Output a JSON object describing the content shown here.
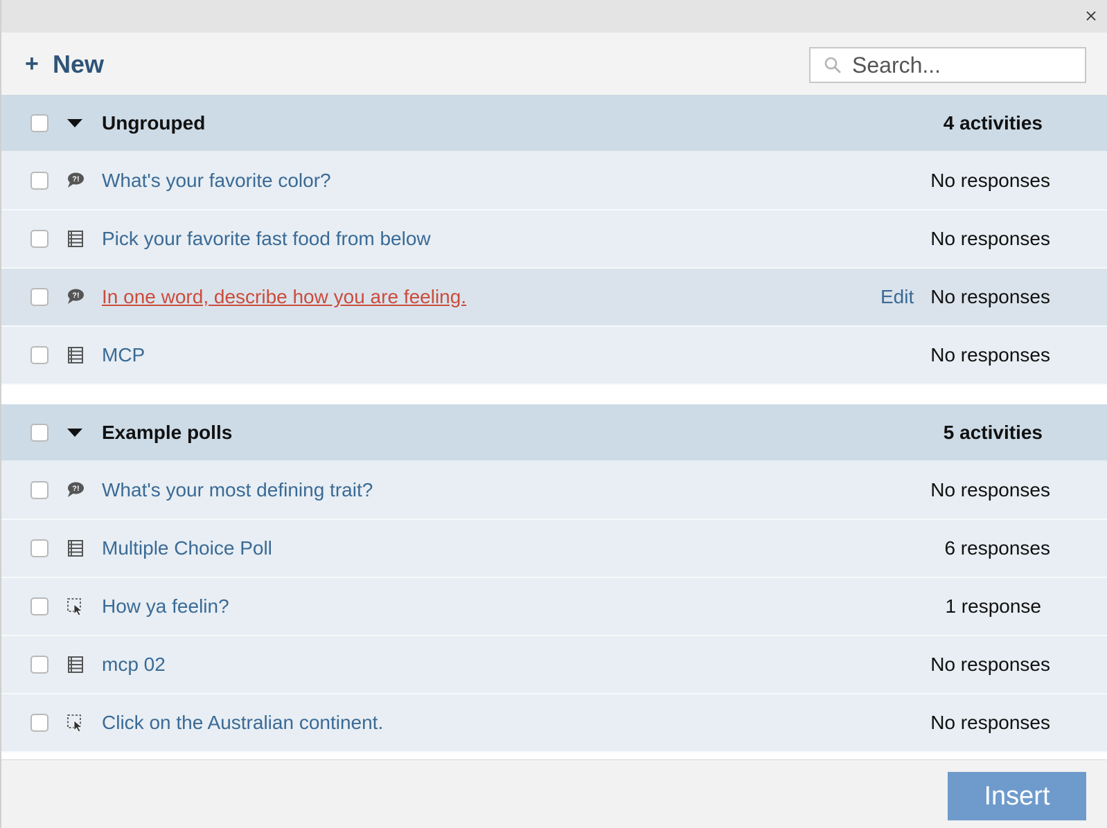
{
  "toolbar": {
    "new_label": "New",
    "plus_glyph": "+",
    "search_placeholder": "Search..."
  },
  "groups": [
    {
      "title": "Ungrouped",
      "count": "4 activities",
      "items": [
        {
          "icon": "speech-bubble-icon",
          "title": "What's your favorite color?",
          "status": "No responses"
        },
        {
          "icon": "list-icon",
          "title": "Pick your favorite fast food from below",
          "status": "No responses"
        },
        {
          "icon": "speech-bubble-icon",
          "title": "In one word, describe how you are feeling.",
          "edit": "Edit",
          "status": "No responses"
        },
        {
          "icon": "list-icon",
          "title": "MCP",
          "status": "No responses"
        }
      ]
    },
    {
      "title": "Example polls",
      "count": "5 activities",
      "items": [
        {
          "icon": "speech-bubble-icon",
          "title": "What's your most defining trait?",
          "status": "No responses"
        },
        {
          "icon": "list-icon",
          "title": "Multiple Choice Poll",
          "status": "6 responses"
        },
        {
          "icon": "clickable-image-icon",
          "title": "How ya feelin?",
          "status": "1 response"
        },
        {
          "icon": "list-icon",
          "title": "mcp 02",
          "status": "No responses"
        },
        {
          "icon": "clickable-image-icon",
          "title": "Click on the Australian continent.",
          "status": "No responses"
        }
      ]
    }
  ],
  "footer": {
    "insert_label": "Insert"
  },
  "colors": {
    "link": "#3a6a96",
    "active_link": "#cc4b3c",
    "group_header_bg": "#cddbe6",
    "row_bg": "#e8eef3",
    "insert_button_bg": "#6f9bcc"
  }
}
